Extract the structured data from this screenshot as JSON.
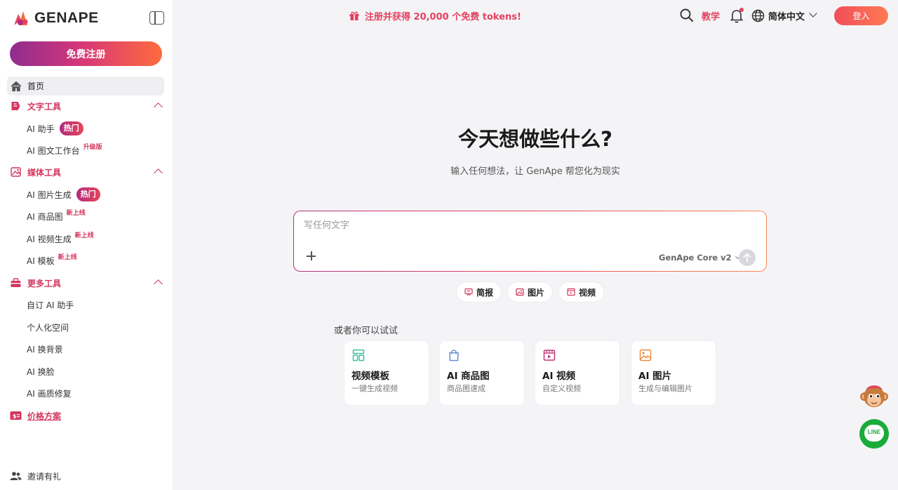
{
  "brand": {
    "name": "GENAPE"
  },
  "sidebar": {
    "signup_label": "免费注册",
    "home_label": "首页",
    "sections": [
      {
        "label": "文字工具",
        "items": [
          {
            "label": "AI 助手",
            "badge": "热门",
            "badge_type": "hot"
          },
          {
            "label": "AI 图文工作台",
            "badge": "升级版",
            "badge_type": "sup"
          }
        ]
      },
      {
        "label": "媒体工具",
        "items": [
          {
            "label": "AI 图片生成",
            "badge": "热门",
            "badge_type": "hot"
          },
          {
            "label": "AI 商品图",
            "badge": "新上线",
            "badge_type": "sup"
          },
          {
            "label": "AI 视频生成",
            "badge": "新上线",
            "badge_type": "sup"
          },
          {
            "label": "AI 模板",
            "badge": "新上线",
            "badge_type": "sup"
          }
        ]
      },
      {
        "label": "更多工具",
        "items": [
          {
            "label": "自订 AI 助手"
          },
          {
            "label": "个人化空间"
          },
          {
            "label": "AI 换背景"
          },
          {
            "label": "AI 换脸"
          },
          {
            "label": "AI 画质修复"
          }
        ]
      }
    ],
    "pricing_label": "价格方案",
    "invite_label": "邀请有礼"
  },
  "topbar": {
    "promo": "注册并获得 20,000 个免费 tokens!",
    "teach": "教学",
    "language": "简体中文",
    "login": "登入"
  },
  "hero": {
    "title": "今天想做些什么?",
    "subtitle": "输入任何想法，让 GenApe 帮您化为现实"
  },
  "prompt": {
    "placeholder": "写任何文字",
    "model": "GenApe Core v2"
  },
  "chips": [
    {
      "label": "简报",
      "icon": "presentation-icon"
    },
    {
      "label": "图片",
      "icon": "image-icon"
    },
    {
      "label": "视频",
      "icon": "video-icon"
    }
  ],
  "suggestions": {
    "label": "或者你可以试试",
    "cards": [
      {
        "title": "视频模板",
        "desc": "一键生成视频",
        "icon": "template-icon",
        "color": "#3fbf9f"
      },
      {
        "title": "AI 商品图",
        "desc": "商品图速成",
        "icon": "shopping-bag-icon",
        "color": "#6b8fd6"
      },
      {
        "title": "AI 视频",
        "desc": "自定义视频",
        "icon": "film-icon",
        "color": "#c0357a"
      },
      {
        "title": "AI 图片",
        "desc": "生成与编辑图片",
        "icon": "picture-icon",
        "color": "#f08a3c"
      }
    ]
  },
  "colors": {
    "accent": "#e5415f",
    "brand_gradient_start": "#8e2d8e",
    "brand_gradient_end": "#ff6a3d"
  }
}
